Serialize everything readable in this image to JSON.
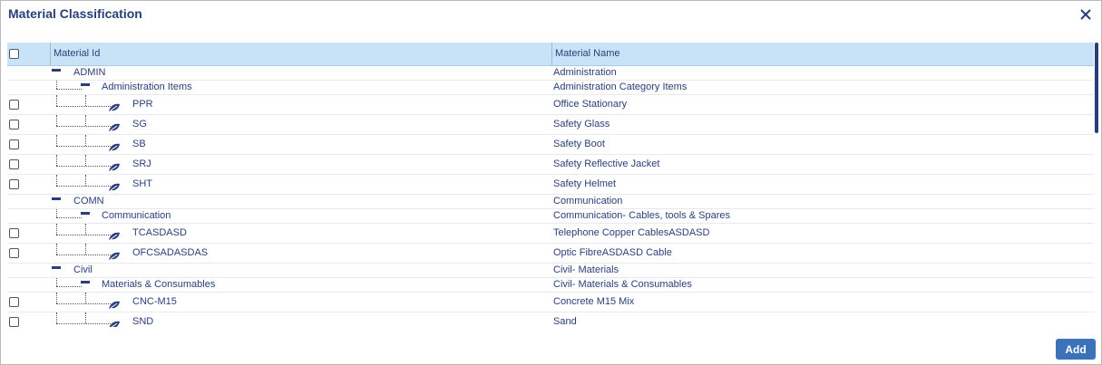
{
  "dialog": {
    "title": "Material Classification",
    "add_label": "Add"
  },
  "grid": {
    "columns": [
      "Material Id",
      "Material Name"
    ],
    "rows": [
      {
        "id": "ADMIN",
        "name": "Administration",
        "level": 0
      },
      {
        "id": "Administration Items",
        "name": "Administration Category Items",
        "level": 1
      },
      {
        "id": "PPR",
        "name": "Office Stationary",
        "level": 2
      },
      {
        "id": "SG",
        "name": "Safety Glass",
        "level": 2
      },
      {
        "id": "SB",
        "name": "Safety Boot",
        "level": 2
      },
      {
        "id": "SRJ",
        "name": "Safety Reflective Jacket",
        "level": 2
      },
      {
        "id": "SHT",
        "name": "Safety Helmet",
        "level": 2
      },
      {
        "id": "COMN",
        "name": "Communication",
        "level": 0
      },
      {
        "id": "Communication",
        "name": "Communication- Cables, tools & Spares",
        "level": 1
      },
      {
        "id": "TCASDASD",
        "name": "Telephone Copper CablesASDASD",
        "level": 2
      },
      {
        "id": "OFCSADASDAS",
        "name": "Optic FibreASDASD Cable",
        "level": 2
      },
      {
        "id": "Civil",
        "name": "Civil- Materials",
        "level": 0
      },
      {
        "id": "Materials & Consumables",
        "name": "Civil- Materials & Consumables",
        "level": 1
      },
      {
        "id": "CNC-M15",
        "name": "Concrete M15 Mix",
        "level": 2
      },
      {
        "id": "SND",
        "name": "Sand",
        "level": 2
      }
    ]
  },
  "colors": {
    "accent": "#2a3f7a",
    "header_bg": "#c8e3f7",
    "button_bg": "#3c72b8"
  },
  "icons": {
    "close": "close-icon",
    "leaf": "leaf-icon",
    "collapse": "collapse-icon"
  }
}
